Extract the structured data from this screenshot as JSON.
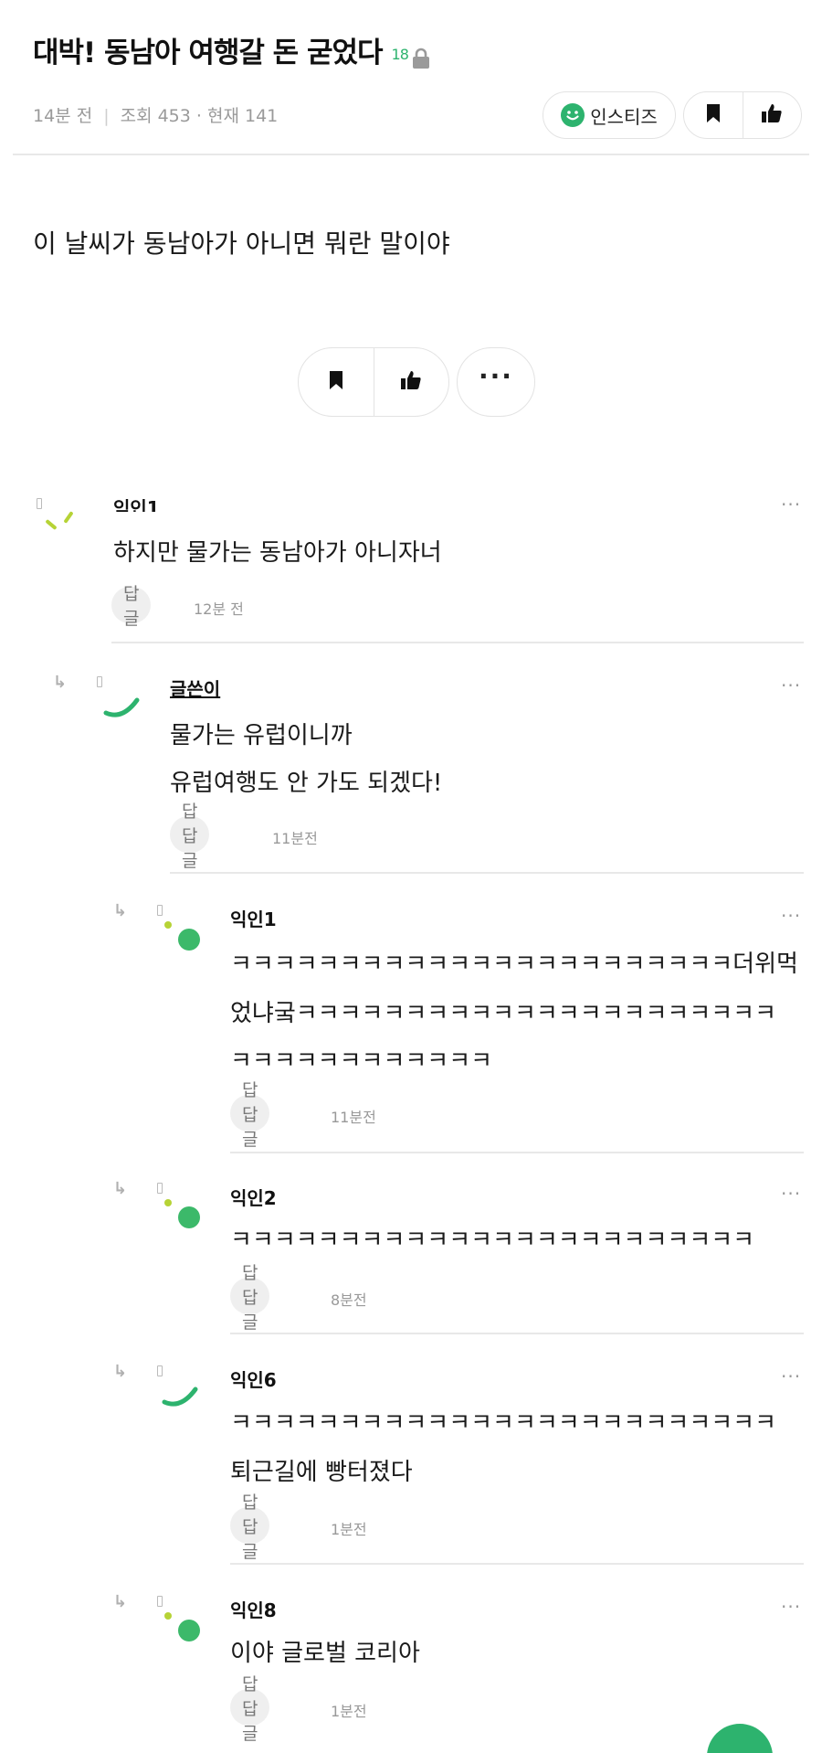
{
  "post": {
    "title": "대박! 동남아 여행갈 돈 굳었다",
    "badge": "18",
    "time": "14분 전",
    "views": "조회 453 · 현재 141",
    "category": "인스티즈",
    "body": "이 날씨가 동남아가 아니면 뭐란 말이야"
  },
  "icons": {
    "lock": "lock-icon",
    "smile": "smile-icon",
    "bookmark": "bookmark-icon",
    "like": "thumbs-up-icon",
    "more": "more-dots-icon",
    "reply_arrow": "reply-arrow-icon"
  },
  "colors": {
    "accent": "#2db36e",
    "text": "#1a1a1a",
    "muted": "#999999"
  },
  "comments": [
    {
      "name": "익인1",
      "lines": [
        "하지만 물가는 동남아가 아니자너"
      ],
      "reply_label": "답글",
      "time": "12분 전",
      "more": "···"
    },
    {
      "name": "글쓴이",
      "lines": [
        "물가는 유럽이니까",
        "유럽여행도 안 가도 되겠다!"
      ],
      "reply_label": "답답글",
      "time": "11분전",
      "more": "···"
    },
    {
      "name": "익인1",
      "lines": [
        "ㅋㅋㅋㅋㅋㅋㅋㅋㅋㅋㅋㅋㅋㅋㅋㅋㅋㅋㅋㅋㅋㅋㅋ더위먹",
        "었냐궄ㅋㅋㅋㅋㅋㅋㅋㅋㅋㅋㅋㅋㅋㅋㅋㅋㅋㅋㅋㅋㅋㅋ",
        "ㅋㅋㅋㅋㅋㅋㅋㅋㅋㅋㅋㅋ"
      ],
      "reply_label": "답답글",
      "time": "11분전",
      "more": "···"
    },
    {
      "name": "익인2",
      "lines": [
        "ㅋㅋㅋㅋㅋㅋㅋㅋㅋㅋㅋㅋㅋㅋㅋㅋㅋㅋㅋㅋㅋㅋㅋㅋ"
      ],
      "reply_label": "답답글",
      "time": "8분전",
      "more": "···"
    },
    {
      "name": "익인6",
      "lines": [
        "ㅋㅋㅋㅋㅋㅋㅋㅋㅋㅋㅋㅋㅋㅋㅋㅋㅋㅋㅋㅋㅋㅋㅋㅋㅋ",
        "퇴근길에 빵터졌다"
      ],
      "reply_label": "답답글",
      "time": "1분전",
      "more": "···"
    },
    {
      "name": "익인8",
      "lines": [
        "이야 글로벌 코리아"
      ],
      "reply_label": "답답글",
      "time": "1분전",
      "more": "···"
    }
  ]
}
